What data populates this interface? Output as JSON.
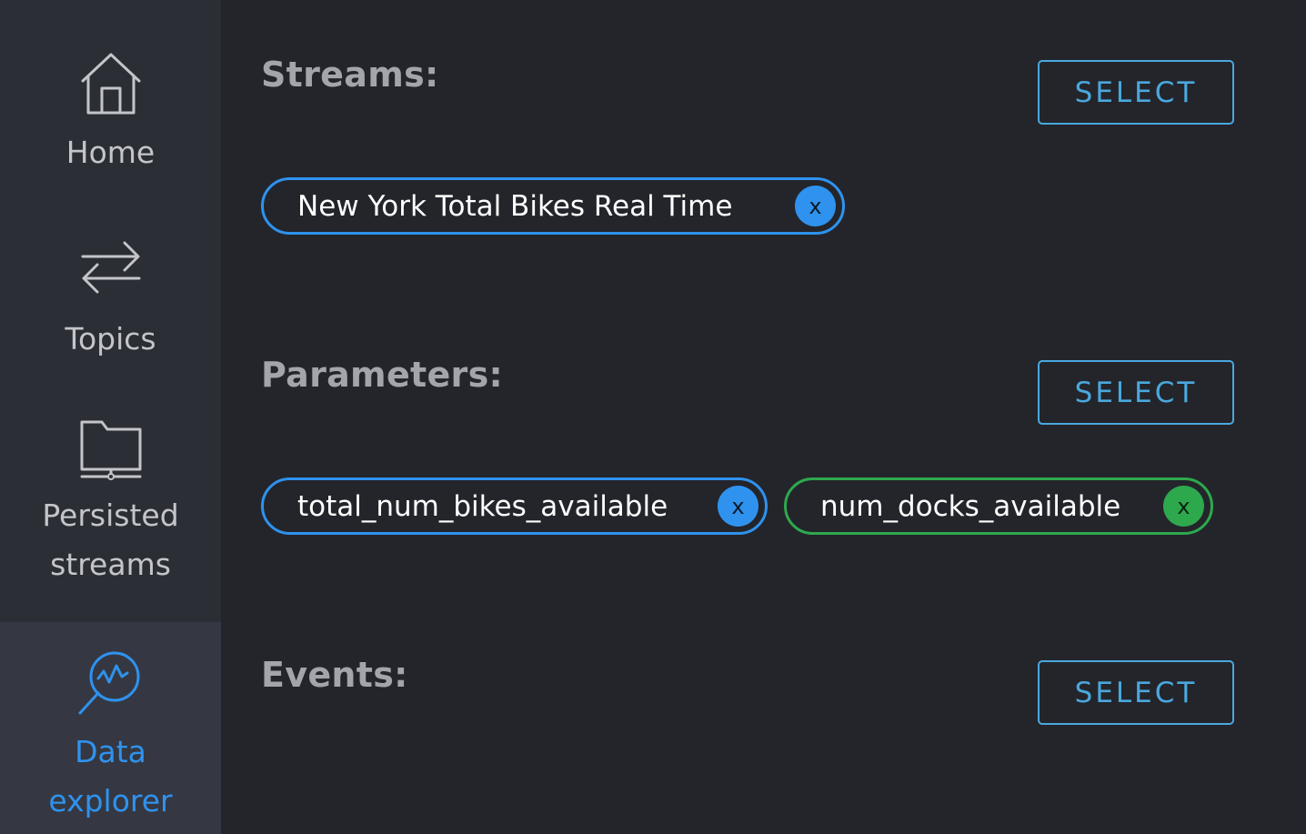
{
  "sidebar": {
    "items": [
      {
        "label": "Home",
        "icon": "home-icon"
      },
      {
        "label": "Topics",
        "icon": "arrows-exchange-icon"
      },
      {
        "label": "Persisted streams",
        "line1": "Persisted",
        "line2": "streams",
        "icon": "folder-icon"
      },
      {
        "label": "Data explorer",
        "line1": "Data",
        "line2": "explorer",
        "icon": "data-search-icon",
        "active": true
      }
    ]
  },
  "sections": {
    "streams": {
      "title": "Streams:",
      "select_label": "SELECT",
      "chips": [
        {
          "label": "New York Total Bikes Real Time",
          "remove_label": "x",
          "color": "#2f92ee"
        }
      ]
    },
    "parameters": {
      "title": "Parameters:",
      "select_label": "SELECT",
      "chips": [
        {
          "label": "total_num_bikes_available",
          "remove_label": "x",
          "color": "#2f92ee"
        },
        {
          "label": "num_docks_available",
          "remove_label": "x",
          "color": "#2ea84d"
        }
      ]
    },
    "events": {
      "title": "Events:",
      "select_label": "SELECT"
    }
  },
  "colors": {
    "background": "#23252b",
    "sidebar": "#2c2e36",
    "active_item": "#353842",
    "accent_blue": "#2f92ee",
    "button_blue": "#4aa8dd",
    "accent_green": "#2ea84d"
  }
}
